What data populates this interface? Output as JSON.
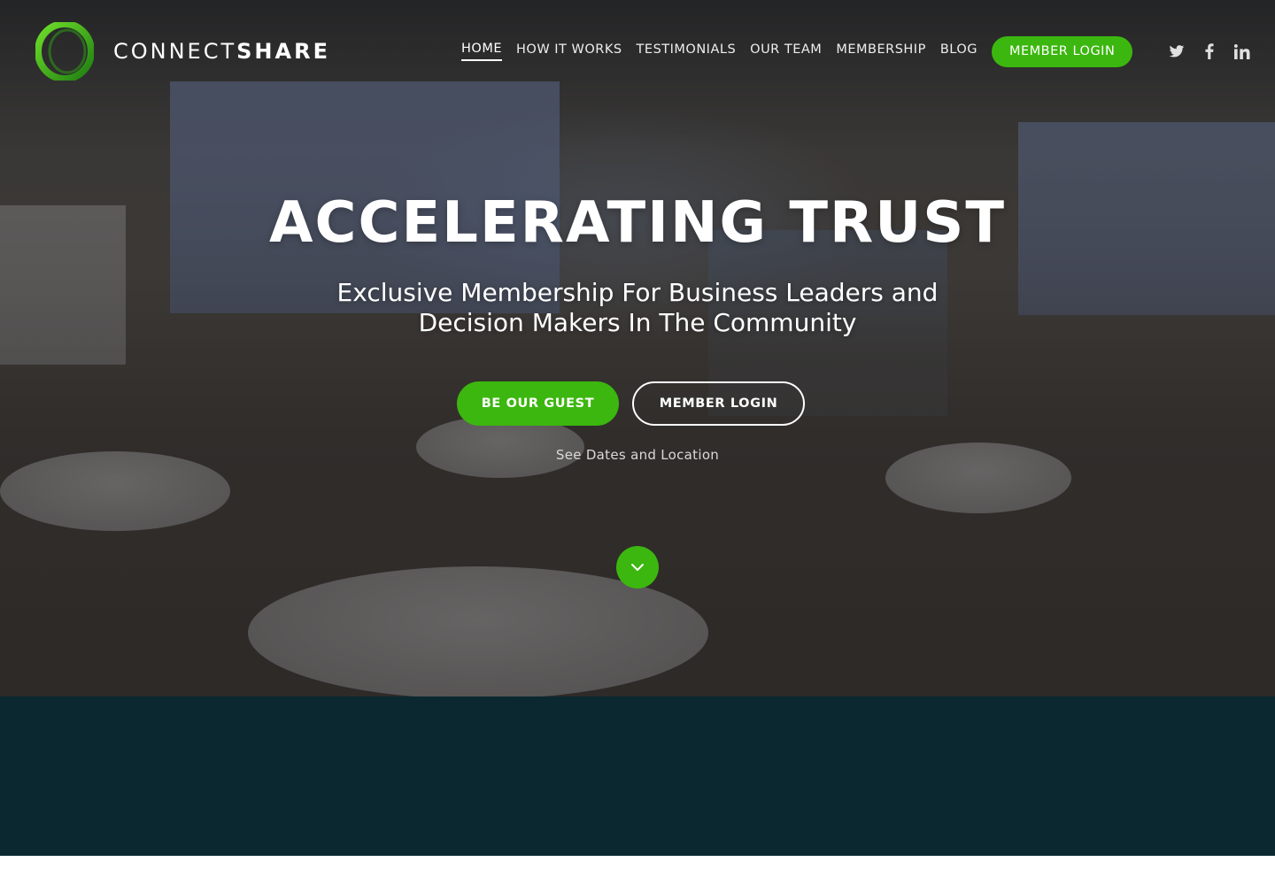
{
  "brand": {
    "logo_text_light": "CONNECT",
    "logo_text_bold": "SHARE",
    "logo_icon": "ring-logo-icon",
    "accent_color": "#3cb70f"
  },
  "nav": {
    "items": [
      {
        "label": "HOME",
        "active": true
      },
      {
        "label": "HOW IT WORKS",
        "active": false
      },
      {
        "label": "TESTIMONIALS",
        "active": false
      },
      {
        "label": "OUR TEAM",
        "active": false
      },
      {
        "label": "MEMBERSHIP",
        "active": false
      },
      {
        "label": "BLOG",
        "active": false
      }
    ],
    "cta_label": "MEMBER LOGIN"
  },
  "social": {
    "icons": [
      "twitter-icon",
      "facebook-icon",
      "linkedin-icon"
    ]
  },
  "hero": {
    "title": "ACCELERATING TRUST",
    "subtitle": "Exclusive Membership For Business Leaders and Decision Makers In The Community",
    "primary_button": "BE OUR GUEST",
    "secondary_button": "MEMBER LOGIN",
    "link_text": "See Dates and Location",
    "scroll_icon": "chevron-down-icon"
  },
  "footer_band": {
    "color": "#0b2830"
  }
}
